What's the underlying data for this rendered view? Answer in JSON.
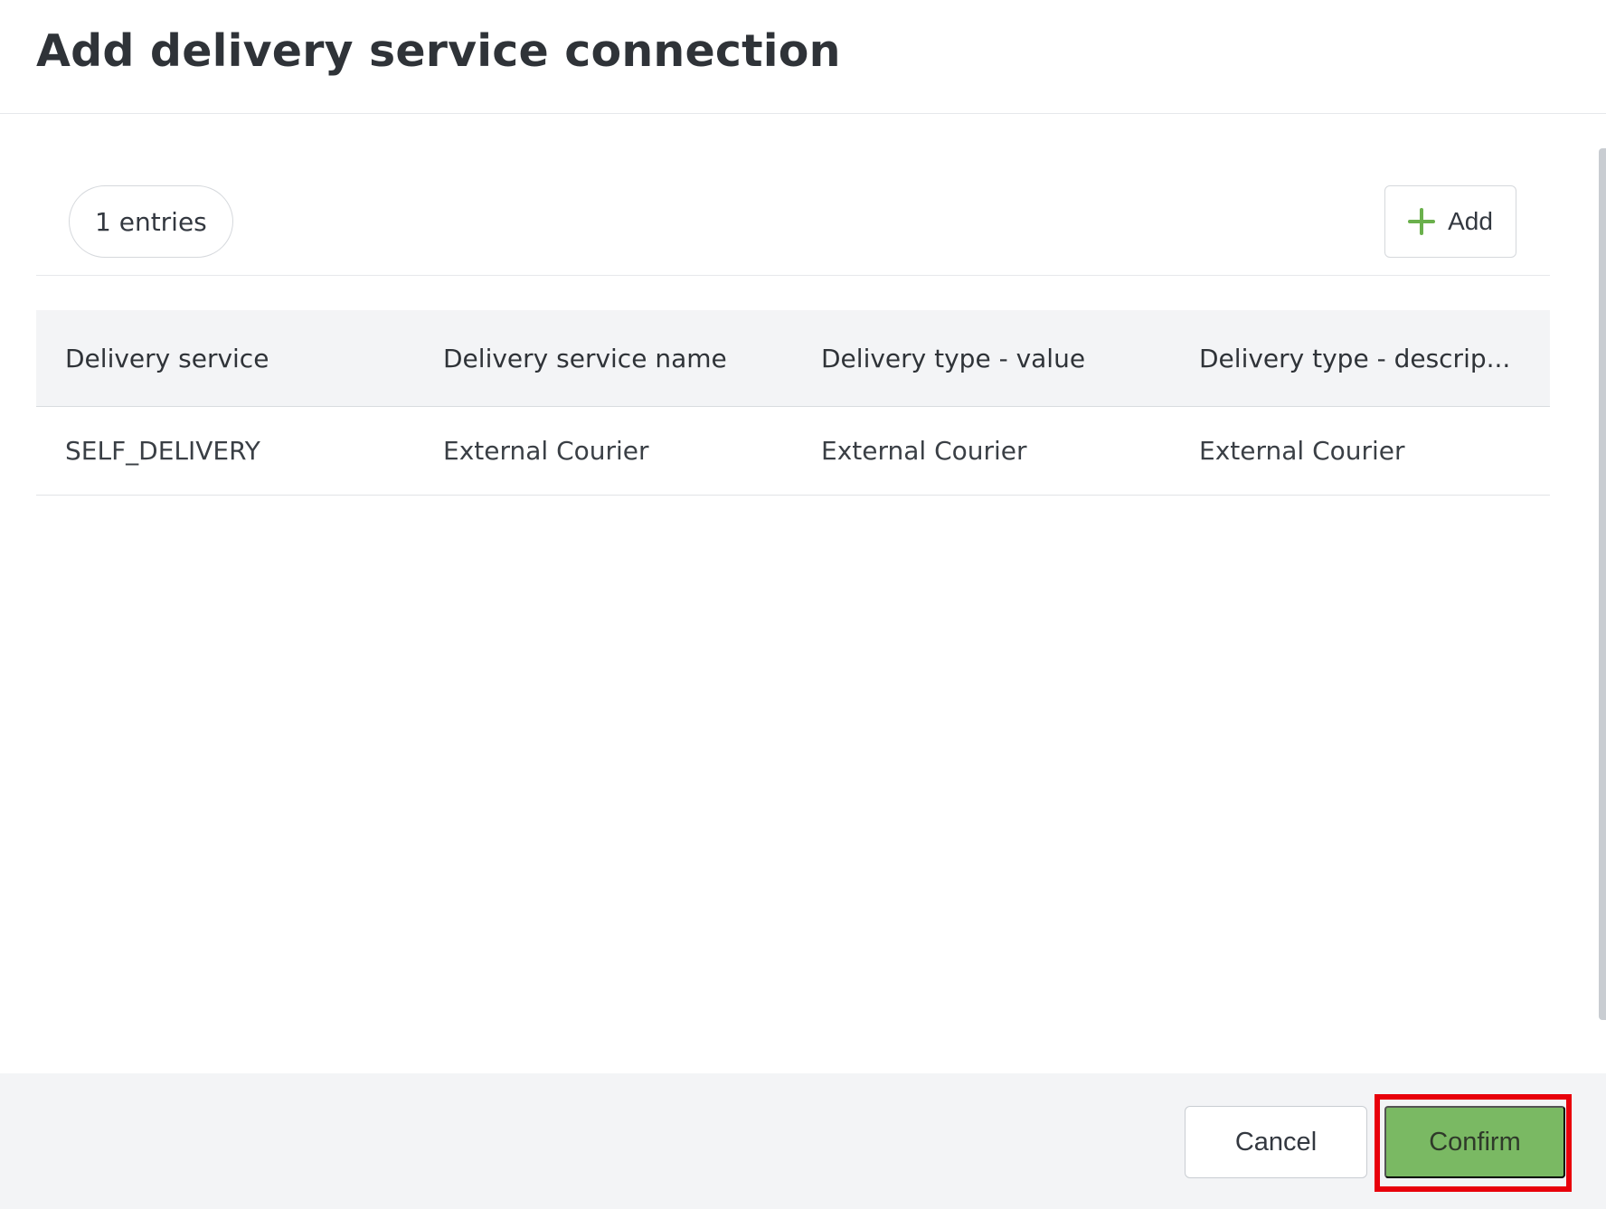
{
  "dialog": {
    "title": "Add delivery service connection"
  },
  "toolbar": {
    "entries_label": "1 entries",
    "add_label": "Add"
  },
  "table": {
    "columns": [
      "Delivery service",
      "Delivery service name",
      "Delivery type - value",
      "Delivery type - descrip..."
    ],
    "rows": [
      [
        "SELF_DELIVERY",
        "External Courier",
        "External Courier",
        "External Courier"
      ]
    ]
  },
  "footer": {
    "cancel_label": "Cancel",
    "confirm_label": "Confirm"
  },
  "colors": {
    "accent_green": "#7ab963",
    "plus_icon_green": "#6ab04c",
    "highlight_red": "#e8000b",
    "footer_bg": "#f3f4f6"
  },
  "icons": {
    "add": "plus-icon"
  }
}
